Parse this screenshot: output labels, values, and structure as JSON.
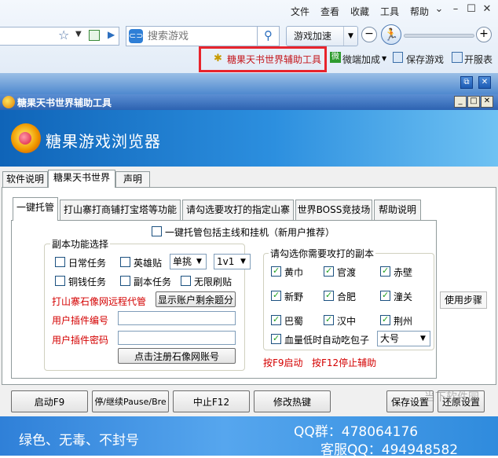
{
  "browser": {
    "menu": [
      "文件",
      "查看",
      "收藏",
      "工具",
      "帮助"
    ],
    "search_placeholder": "搜索游戏",
    "search_logo": "⊂⊃",
    "game_speed_label": "游戏加速",
    "toolbar": {
      "candy_tool": "糖果天书世界辅助工具",
      "micro_addon": "微端加成",
      "save_game": "保存游戏",
      "open_nav": "开服表"
    },
    "micro_icon_text": "微"
  },
  "helper": {
    "title": "糖果天书世界辅助工具",
    "banner_title": "糖果游戏浏览器",
    "tabs": [
      "软件说明",
      "糖果天书世界",
      "声明"
    ],
    "subtabs": [
      "一键托管",
      "打山寨打商铺打宝塔等功能",
      "请勾选要攻打的指定山寨",
      "世界BOSS竞技场",
      "帮助说明"
    ],
    "one_click_main": "一键托管包括主线和挂机（新用户推荐）",
    "dungeon_group_title": "副本功能选择",
    "options": {
      "daily_task": "日常任务",
      "hero_post": "英雄贴",
      "copper_task": "铜钱任务",
      "dungeon_task": "副本任务",
      "infinite_refresh": "无限刷贴"
    },
    "select_mode": "单挑",
    "select_team": "1v1",
    "remote_proxy_label": "打山寨石像网远程代管",
    "show_balance_btn": "显示账户剩余题分",
    "plugin_id_label": "用户插件编号",
    "plugin_pwd_label": "用户插件密码",
    "register_btn": "点击注册石像网账号",
    "target_group_title": "请勾选你需要攻打的副本",
    "targets": [
      "黄巾",
      "官渡",
      "赤壁",
      "新野",
      "合肥",
      "潼关",
      "巴蜀",
      "汉中",
      "荆州"
    ],
    "low_hp_label": "血量低时自动吃包子",
    "potion_size": "大号",
    "hotkey_hint": "按F9启动   按F12停止辅助",
    "usage_steps": "使用步骤",
    "bottom_buttons": {
      "start": "启动F9",
      "pause": "停/继续Pause/Bre",
      "stop": "中止F12",
      "hotkey": "修改热键",
      "save": "保存设置",
      "restore": "还原设置"
    },
    "footer": {
      "slogan": "绿色、无毒、不封号",
      "qq_group": "QQ群：478064176",
      "support_qq": "客服QQ：494948582"
    },
    "watermark": "当下软件园"
  }
}
